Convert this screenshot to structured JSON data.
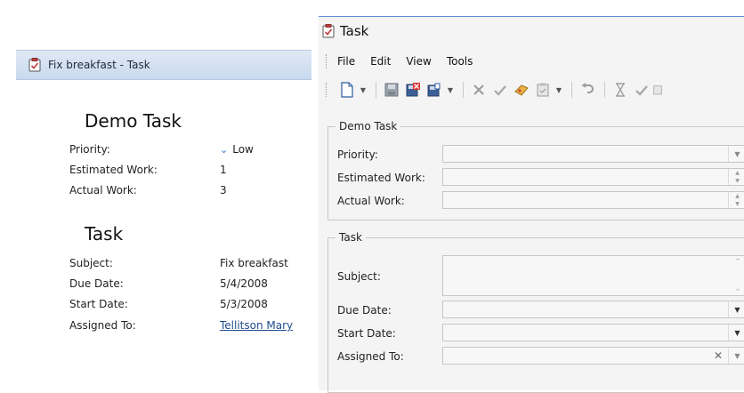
{
  "left": {
    "window_title": "Fix breakfast - Task",
    "demo_section": {
      "title": "Demo Task",
      "fields": [
        {
          "label": "Priority:",
          "value": "Low"
        },
        {
          "label": "Estimated Work:",
          "value": "1"
        },
        {
          "label": "Actual Work:",
          "value": "3"
        }
      ]
    },
    "task_section": {
      "title": "Task",
      "fields": [
        {
          "label": "Subject:",
          "value": "Fix breakfast"
        },
        {
          "label": "Due Date:",
          "value": "5/4/2008"
        },
        {
          "label": "Start Date:",
          "value": "5/3/2008"
        },
        {
          "label": "Assigned To:",
          "value": "Tellitson Mary"
        }
      ]
    }
  },
  "right": {
    "window_title": "Task",
    "menu": [
      "File",
      "Edit",
      "View",
      "Tools"
    ],
    "toolbar_icons": [
      "new-icon",
      "save-icon",
      "save-close-icon",
      "save-new-icon",
      "delete-icon",
      "validate-icon",
      "change-icon",
      "clipboard-icon",
      "undo-icon",
      "hourglass-icon",
      "check-icon"
    ],
    "demo_group": {
      "caption": "Demo Task",
      "fields": [
        "Priority:",
        "Estimated Work:",
        "Actual Work:"
      ]
    },
    "task_group": {
      "caption": "Task",
      "fields": [
        "Subject:",
        "Due Date:",
        "Start Date:",
        "Assigned To:"
      ]
    }
  },
  "colors": {
    "titlebar_blue": "#c9d9ee",
    "link": "#1f4e8c",
    "accent_border": "#5b8fd6"
  }
}
